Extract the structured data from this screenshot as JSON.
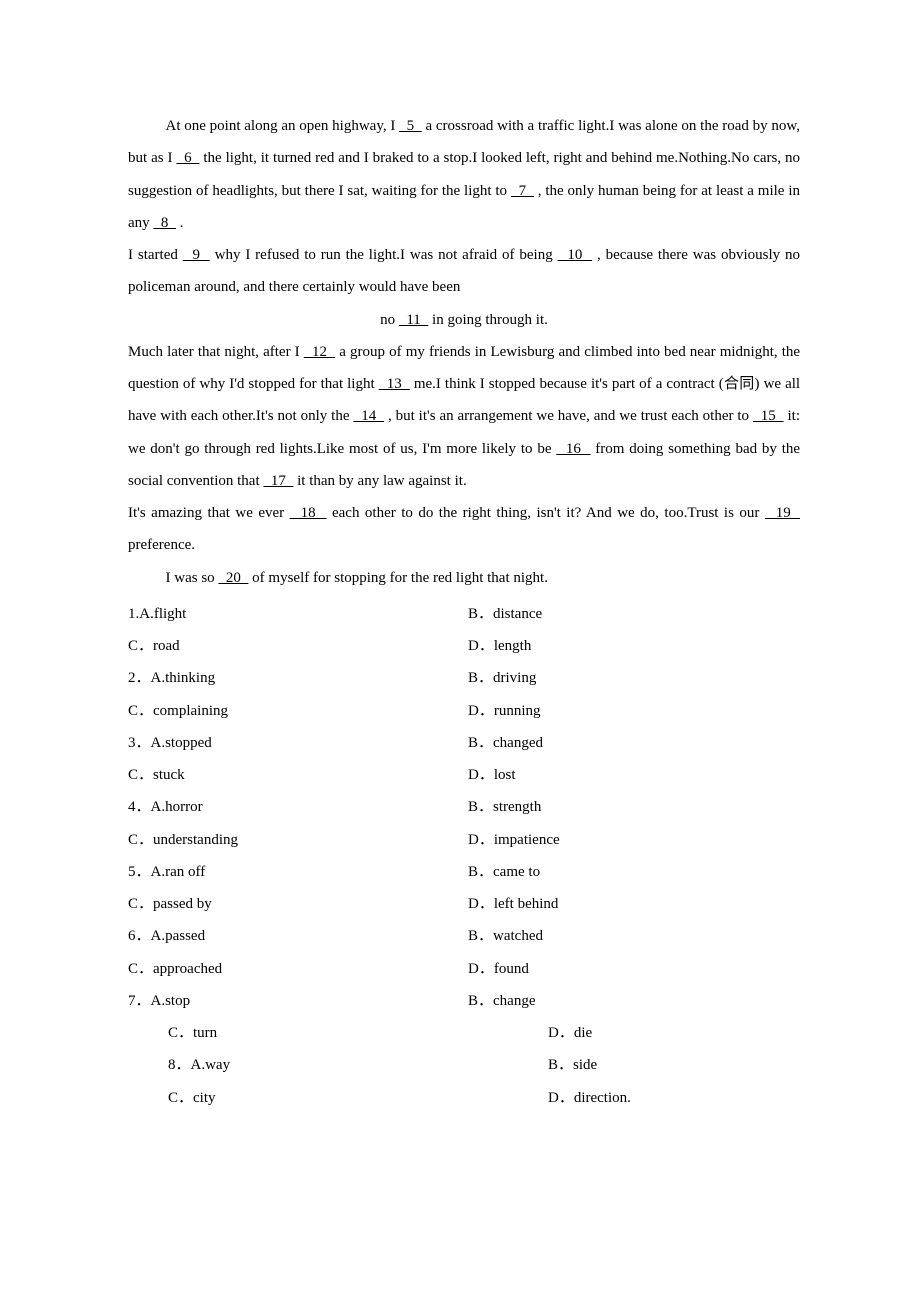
{
  "p1_prefix": "At one point along an open highway, I",
  "b5": "  5  ",
  "p1_mid1": "a crossroad with a traffic light.I was alone on the road by now, but as I",
  "b6": "  6  ",
  "p1_mid2": "the light, it turned red and I braked to a stop.I looked left, right and behind me.Nothing.No cars, no suggestion of headlights, but there I sat, waiting for the light to",
  "b7": "  7  ",
  "p1_mid3": ", the only human being for at least a mile in any ",
  "b8": "  8  ",
  "p1_end": ".",
  "p2_prefix": "I started",
  "b9": "  9  ",
  "p2_mid1": "why I refused to run the light.I was not  afraid of being",
  "b10": "  10  ",
  "p2_mid2": ", because there was obviously no policeman around, and there certainly would have been",
  "p2_center_pre": "no",
  "b11": "  11  ",
  "p2_center_post": "in going through it.",
  "p3_prefix": "Much later that night, after I",
  "b12": "  12  ",
  "p3_mid1": "a group of my  friends in Lewisburg and climbed into bed near midnight, the question of why I'd stopped for that light",
  "b13": "  13  ",
  "p3_mid2": "me.I think I stopped because it's part of a contract",
  "p3_cjk": "(合同)",
  "p3_mid3": "we all have with each other.It's not only the",
  "b14": "  14  ",
  "p3_mid4": ", but it's an arrangement we have, and we trust each other to",
  "b15": "  15  ",
  "p3_mid5": "it: we don't go  through red lights.Like most of us, I'm more likely to be",
  "b16": "  16  ",
  "p3_mid6": "from doing something bad by the social convention  that",
  "b17": "  17  ",
  "p3_end": "it than by any law against it.",
  "p4_prefix": "It's amazing that we ever",
  "b18": "  18  ",
  "p4_mid1": "each other to do the right thing, isn't it? And we do, too.Trust is our",
  "b19": "  19  ",
  "p4_end": "preference.",
  "p5_prefix": "I was so",
  "b20": "  20  ",
  "p5_end": "of myself for stopping for the red light that night.",
  "options": [
    {
      "num": "1.",
      "a": "A.flight",
      "b": "B．distance",
      "c": "C．road",
      "d": "D．length",
      "indentCD": false
    },
    {
      "num": "2．",
      "a": "A.thinking",
      "b": "B．driving",
      "c": "C．complaining",
      "d": "D．running",
      "indentCD": false
    },
    {
      "num": "3．",
      "a": "A.stopped",
      "b": "B．changed",
      "c": "C．stuck",
      "d": "D．lost",
      "indentCD": false
    },
    {
      "num": "4．",
      "a": "A.horror",
      "b": "B．strength",
      "c": "C．understanding",
      "d": "D．impatience",
      "indentCD": false
    },
    {
      "num": "5．",
      "a": "A.ran off",
      "b": "B．came to",
      "c": "C．passed by",
      "d": "D．left behind",
      "indentCD": false
    },
    {
      "num": "6．",
      "a": "A.passed",
      "b": "B．watched",
      "c": "C．approached",
      "d": "D．found",
      "indentCD": false
    },
    {
      "num": "7．",
      "a": "A.stop",
      "b": "B．change",
      "c": "C．turn",
      "d": "D．die",
      "indentCD": true
    },
    {
      "num": "8．",
      "a": "A.way",
      "b": "B．side",
      "c": "C．city",
      "d": "D．direction.",
      "indentCD": true,
      "indentAB": true
    }
  ]
}
